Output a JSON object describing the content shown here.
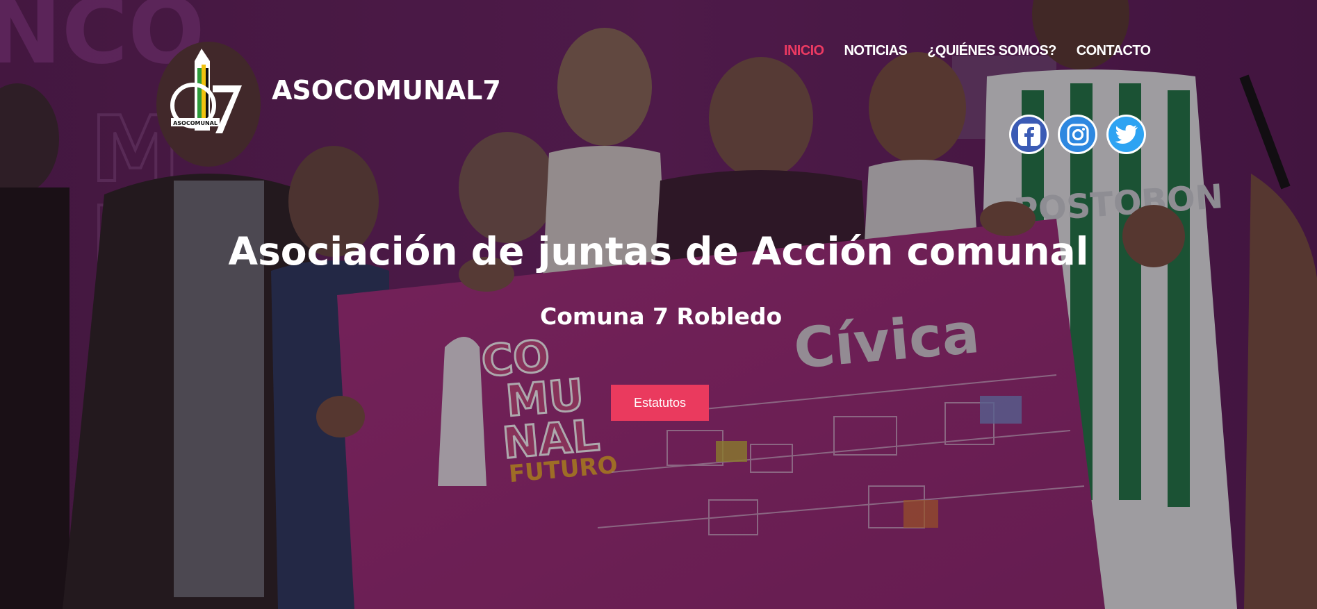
{
  "site": {
    "brand": "ASOCOMUNAL7",
    "logo_text": "ASOCOMUNAL"
  },
  "nav": {
    "items": [
      {
        "label": "INICIO",
        "active": true
      },
      {
        "label": "NOTICIAS",
        "active": false
      },
      {
        "label": "¿QUIÉNES SOMOS?",
        "active": false
      },
      {
        "label": "CONTACTO",
        "active": false
      }
    ]
  },
  "socials": [
    {
      "icon": "facebook-icon"
    },
    {
      "icon": "instagram-icon"
    },
    {
      "icon": "twitter-icon"
    }
  ],
  "hero": {
    "title": "Asociación de juntas de Acción comunal",
    "subtitle": "Comuna 7 Robledo",
    "cta_label": "Estatutos",
    "background_text": [
      "CO",
      "MU",
      "NAL",
      "FUTURO",
      "Cívica",
      "POSTOBON"
    ]
  },
  "colors": {
    "accent": "#ec3a62",
    "button": "#ea3a5e",
    "background_purple": "#7a2a78",
    "card_magenta": "#b02a8a"
  }
}
